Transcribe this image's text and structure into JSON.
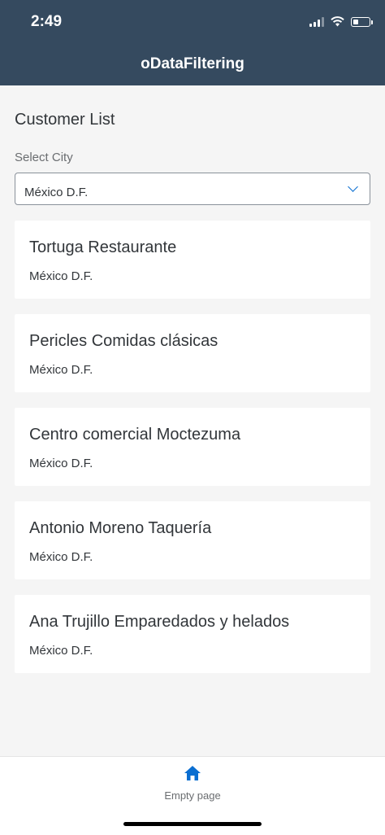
{
  "status_bar": {
    "time": "2:49",
    "battery_level": 0.35
  },
  "header": {
    "title": "oDataFiltering"
  },
  "main": {
    "section_title": "Customer List",
    "select_label": "Select City",
    "selected_city": "México D.F.",
    "customers": [
      {
        "name": "Tortuga Restaurante",
        "city": "México D.F."
      },
      {
        "name": "Pericles Comidas clásicas",
        "city": "México D.F."
      },
      {
        "name": "Centro comercial Moctezuma",
        "city": "México D.F."
      },
      {
        "name": "Antonio Moreno Taquería",
        "city": "México D.F."
      },
      {
        "name": "Ana Trujillo Emparedados y helados",
        "city": "México D.F."
      }
    ]
  },
  "tabbar": {
    "tab_label": "Empty page",
    "tab_icon": "home-icon"
  },
  "colors": {
    "header_bg": "#354a5f",
    "accent": "#0a6ed1",
    "page_bg": "#f5f5f5"
  }
}
